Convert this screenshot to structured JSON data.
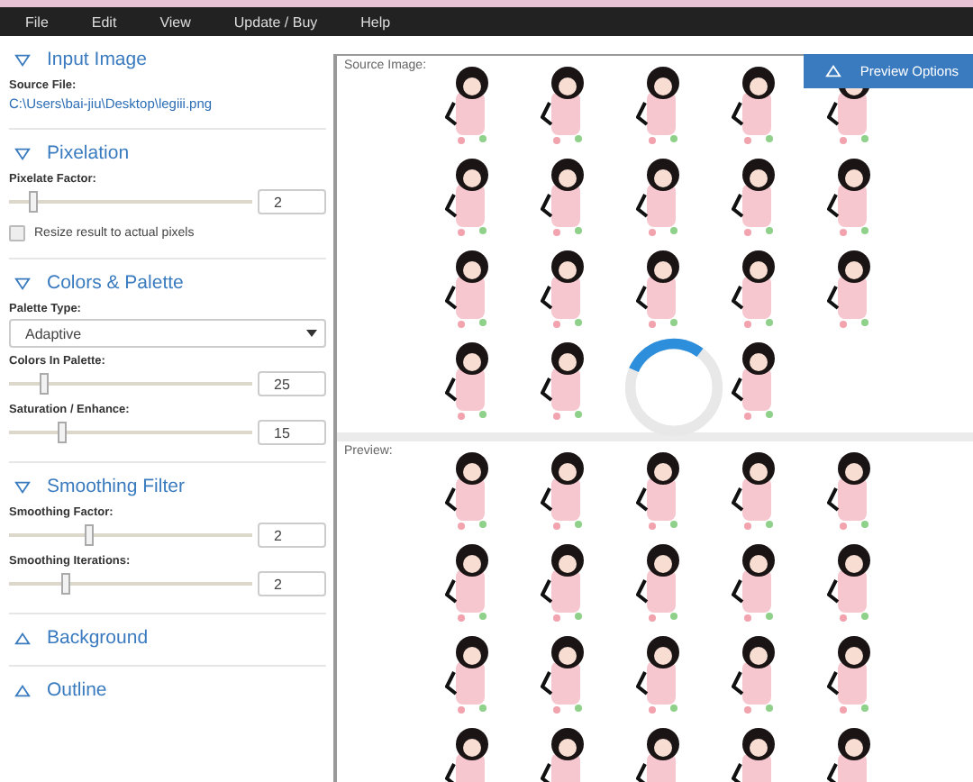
{
  "menu": [
    "File",
    "Edit",
    "View",
    "Update / Buy",
    "Help"
  ],
  "sections": [
    {
      "title": "Input Image",
      "expanded": true,
      "controls": [
        {
          "kind": "file",
          "label": "Source File:",
          "value": "C:\\Users\\bai-jiu\\Desktop\\legiii.png"
        }
      ]
    },
    {
      "title": "Pixelation",
      "expanded": true,
      "controls": [
        {
          "kind": "slider",
          "label": "Pixelate Factor:",
          "level": 0.1,
          "value": "2"
        },
        {
          "kind": "checkbox",
          "label": "Resize result to actual pixels",
          "checked": false
        }
      ]
    },
    {
      "title": "Colors & Palette",
      "expanded": true,
      "controls": [
        {
          "kind": "select",
          "label": "Palette Type:",
          "value": "Adaptive"
        },
        {
          "kind": "slider",
          "label": "Colors In Palette:",
          "level": 0.15,
          "value": "25"
        },
        {
          "kind": "slider",
          "label": "Saturation / Enhance:",
          "level": 0.22,
          "value": "15"
        }
      ]
    },
    {
      "title": "Smoothing Filter",
      "expanded": true,
      "controls": [
        {
          "kind": "slider",
          "label": "Smoothing Factor:",
          "level": 0.33,
          "value": "2"
        },
        {
          "kind": "slider",
          "label": "Smoothing Iterations:",
          "level": 0.24,
          "value": "2"
        }
      ]
    },
    {
      "title": "Background",
      "expanded": false
    },
    {
      "title": "Outline",
      "expanded": false
    }
  ],
  "preview_options": "Preview Options",
  "source_label": "Source Image:",
  "preview_label": "Preview:"
}
